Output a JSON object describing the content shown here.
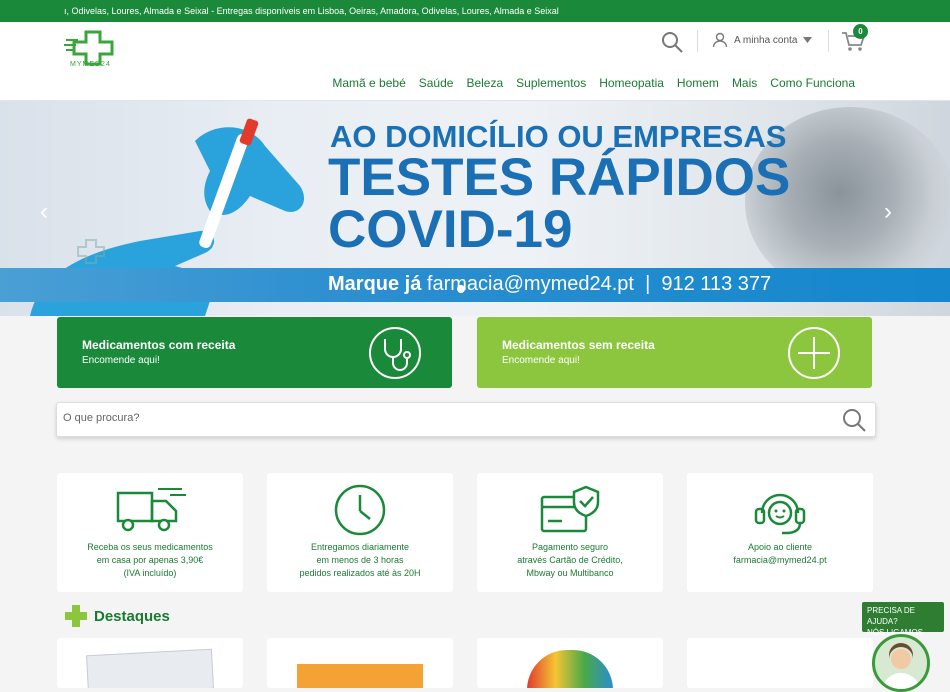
{
  "topbar": {
    "text": "ı, Odivelas, Loures, Almada e Seixal - Entregas disponíveis em Lisboa, Oeiras, Amadora, Odivelas, Loures, Almada e Seixal"
  },
  "header": {
    "logo_text": "MYMED24",
    "account_label": "A minha conta",
    "cart_count": "0",
    "nav": [
      "Mamã e bebé",
      "Saúde",
      "Beleza",
      "Suplementos",
      "Homeopatia",
      "Homem",
      "Mais",
      "Como Funciona"
    ]
  },
  "hero": {
    "line1": "AO DOMICÍLIO OU EMPRESAS",
    "line2": "TESTES RÁPIDOS",
    "line3": "COVID-19",
    "strip_bold": "Marque já",
    "strip_text": " farmacia@mymed24.pt  |  912 113 377",
    "prev": "‹",
    "next": "›"
  },
  "cards": [
    {
      "title": "Medicamentos com receita",
      "sub": "Encomende aqui!",
      "color": "#1a8a3a"
    },
    {
      "title": "Medicamentos sem receita",
      "sub": "Encomende aqui!",
      "color": "#8cc63f"
    }
  ],
  "search": {
    "placeholder": "O que procura?"
  },
  "features": [
    {
      "l1": "Receba os seus medicamentos",
      "l2": "em casa por apenas 3,90€",
      "l3": "(IVA incluído)",
      "icon": "truck-icon"
    },
    {
      "l1": "Entregamos diariamente",
      "l2": "em menos de 3 horas",
      "l3": "pedidos realizados até às 20H",
      "icon": "clock-icon"
    },
    {
      "l1": "Pagamento seguro",
      "l2": "através Cartão de Crédito,",
      "l3": "Mbway ou Multibanco",
      "icon": "secure-payment-icon"
    },
    {
      "l1": "Apoio ao cliente",
      "l2": "farmacia@mymed24.pt",
      "l3": "",
      "icon": "headset-icon"
    }
  ],
  "section": {
    "title": "Destaques"
  },
  "help": {
    "l1": "PRECISA DE AJUDA?",
    "l2": "NÓS LIGAMOS"
  },
  "colors": {
    "brand_green": "#1a8a3a",
    "light_green": "#8cc63f",
    "hero_blue": "#1b6fb5"
  }
}
